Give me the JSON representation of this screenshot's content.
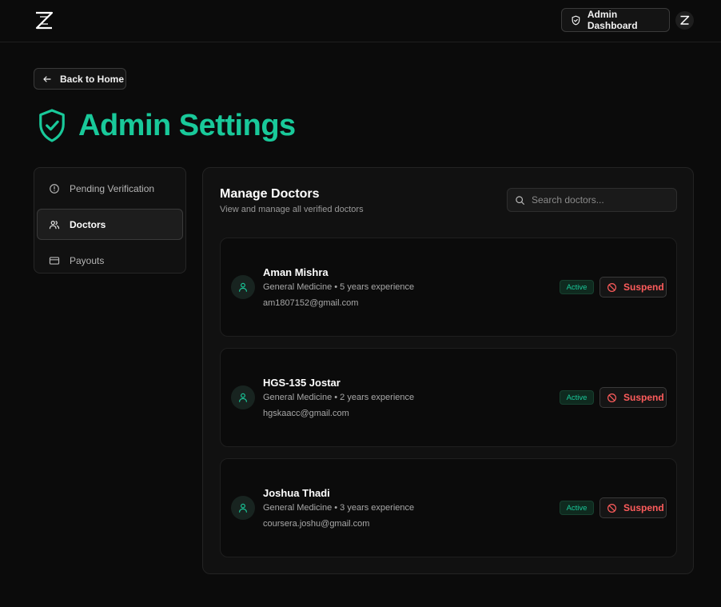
{
  "header": {
    "admin_dashboard_label": "Admin Dashboard"
  },
  "back_label": "Back to Home",
  "page_title": "Admin Settings",
  "sidebar": {
    "items": [
      {
        "label": "Pending Verification",
        "icon": "alert-circle-icon",
        "active": false
      },
      {
        "label": "Doctors",
        "icon": "users-icon",
        "active": true
      },
      {
        "label": "Payouts",
        "icon": "credit-card-icon",
        "active": false
      }
    ]
  },
  "panel": {
    "title": "Manage Doctors",
    "subtitle": "View and manage all verified doctors",
    "search_placeholder": "Search doctors..."
  },
  "doctors": [
    {
      "name": "Aman Mishra",
      "specialty": "General Medicine • 5 years experience",
      "email": "am1807152@gmail.com",
      "status": "Active",
      "action": "Suspend"
    },
    {
      "name": "HGS-135 Jostar",
      "specialty": "General Medicine • 2 years experience",
      "email": "hgskaacc@gmail.com",
      "status": "Active",
      "action": "Suspend"
    },
    {
      "name": "Joshua Thadi",
      "specialty": "General Medicine • 3 years experience",
      "email": "coursera.joshu@gmail.com",
      "status": "Active",
      "action": "Suspend"
    }
  ],
  "colors": {
    "accent": "#19c99a",
    "danger": "#ff5c5c",
    "background": "#0b0b0b"
  }
}
